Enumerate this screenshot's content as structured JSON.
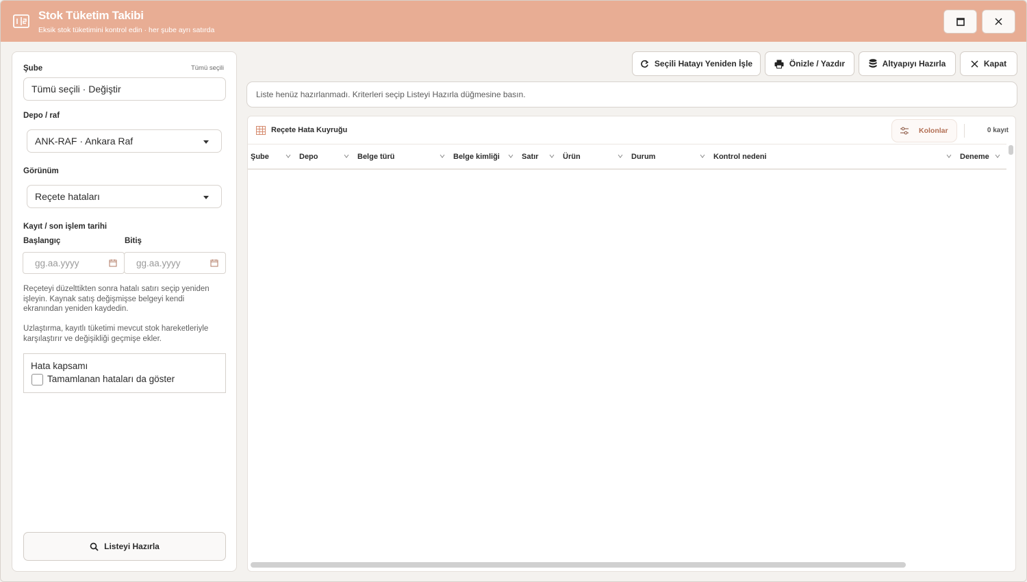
{
  "window": {
    "title": "Stok Tüketim Takibi",
    "subtitle": "Eksik stok tüketimini kontrol edin · her şube ayrı satırda",
    "accent_color": "#e8ad94"
  },
  "filters": {
    "branch_label": "Şube",
    "branch_hint": "Tümü seçili",
    "branch_value": "Tümü seçili · Değiştir",
    "depot_label": "Depo / raf",
    "depot_value": "ANK-RAF · Ankara Raf",
    "view_label": "Görünüm",
    "view_value": "Reçete hataları",
    "date_section_label": "Kayıt / son işlem tarihi",
    "start_label": "Başlangıç",
    "end_label": "Bitiş",
    "start_placeholder": "gg.aa.yyyy",
    "end_placeholder": "gg.aa.yyyy",
    "help_text_1": "Reçeteyi düzelttikten sonra hatalı satırı seçip yeniden işleyin. Kaynak satış değişmişse belgeyi kendi ekranından yeniden kaydedin.",
    "help_text_2": "Uzlaştırma, kayıtlı tüketimi mevcut stok hareketleriyle karşılaştırır ve değişikliği geçmişe ekler.",
    "scope_title": "Hata kapsamı",
    "scope_checkbox_label": "Tamamlanan hataları da göster",
    "prepare_button": "Listeyi Hazırla"
  },
  "toolbar": {
    "reprocess": "Seçili Hatayı Yeniden İşle",
    "preview_print": "Önizle / Yazdır",
    "prepare_infra": "Altyapıyı Hazırla",
    "close": "Kapat"
  },
  "notice": "Liste henüz hazırlanmadı. Kriterleri seçip Listeyi Hazırla düğmesine basın.",
  "grid": {
    "title": "Reçete Hata Kuyruğu",
    "columns_button": "Kolonlar",
    "record_count": "0 kayıt",
    "columns": [
      "Şube",
      "Depo",
      "Belge türü",
      "Belge kimliği",
      "Satır",
      "Ürün",
      "Durum",
      "Kontrol nedeni",
      "Deneme"
    ],
    "rows": []
  }
}
